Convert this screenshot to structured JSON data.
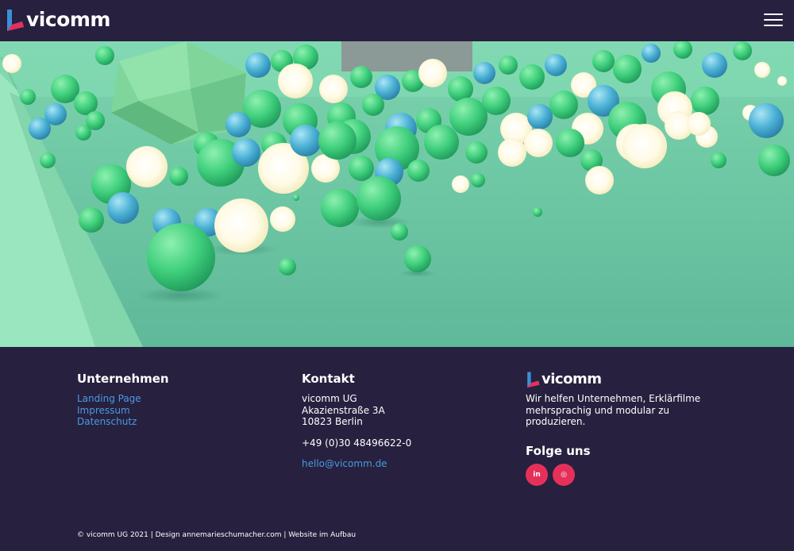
{
  "header": {
    "brand": "vicomm",
    "logo_icon": "vicomm-logo-mark",
    "menu_icon": "hamburger-menu-icon"
  },
  "hero": {
    "image_subject": "hero-spheres-image"
  },
  "footer": {
    "unternehmen": {
      "title": "Unternehmen",
      "links": [
        "Landing Page",
        "Impressum",
        "Datenschutz"
      ]
    },
    "kontakt": {
      "title": "Kontakt",
      "address": [
        "vicomm UG",
        "Akazienstraße 3A",
        "10823 Berlin"
      ],
      "phone": "+49 (0)30 48496622-0",
      "email": "hello@vicomm.de"
    },
    "about": {
      "brand": "vicomm",
      "tagline": "Wir helfen Unternehmen, Erklärfilme mehrsprachig und modular zu produzieren.",
      "follow_title": "Folge uns",
      "social": [
        {
          "icon": "linkedin-icon",
          "label": "in"
        },
        {
          "icon": "instagram-icon",
          "label": "◎"
        }
      ]
    },
    "copyright": "© vicomm UG 2021 | Design annemarieschumacher.com | Website im Aufbau"
  },
  "colors": {
    "background": "#27203f",
    "link": "#4a9be0",
    "social": "#e5305a",
    "logo_red": "#e5305a",
    "logo_blue": "#3b8fd8"
  }
}
